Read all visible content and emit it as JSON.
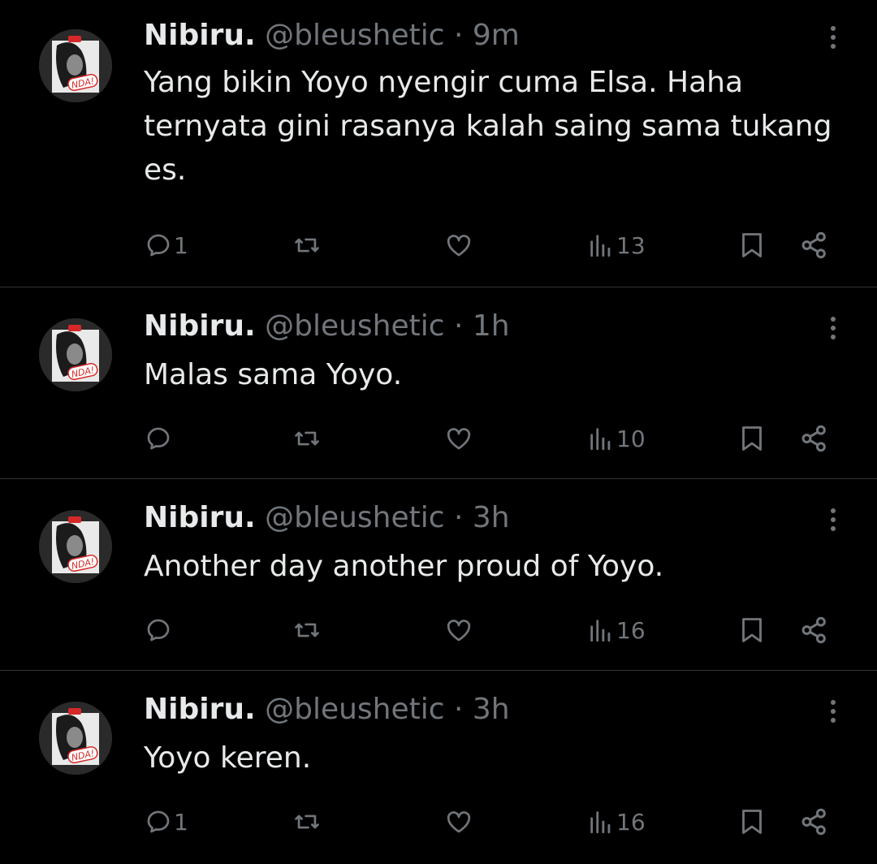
{
  "tweets": [
    {
      "name": "Nibiru.",
      "handle": "@bleushetic",
      "separator": "·",
      "time": "9m",
      "text": "Yang bikin Yoyo nyengir cuma Elsa. Haha ternyata gini rasanya kalah saing sama tukang es.",
      "replies": "1",
      "views": "13",
      "avatar_badge": "NDA!"
    },
    {
      "name": "Nibiru.",
      "handle": "@bleushetic",
      "separator": "·",
      "time": "1h",
      "text": "Malas sama Yoyo.",
      "replies": "",
      "views": "10",
      "avatar_badge": "NDA!"
    },
    {
      "name": "Nibiru.",
      "handle": "@bleushetic",
      "separator": "·",
      "time": "3h",
      "text": "Another day another proud of Yoyo.",
      "replies": "",
      "views": "16",
      "avatar_badge": "NDA!"
    },
    {
      "name": "Nibiru.",
      "handle": "@bleushetic",
      "separator": "·",
      "time": "3h",
      "text": "Yoyo keren.",
      "replies": "1",
      "views": "16",
      "avatar_badge": "NDA!"
    }
  ],
  "icons": {
    "reply": "reply-icon",
    "retweet": "retweet-icon",
    "like": "like-icon",
    "views": "views-icon",
    "bookmark": "bookmark-icon",
    "share": "share-icon",
    "more": "more-icon"
  },
  "colors": {
    "background": "#000000",
    "primary_text": "#e7e9ea",
    "secondary_text": "#71767b",
    "divider": "#2f3336",
    "avatar_accent": "#d62828"
  }
}
